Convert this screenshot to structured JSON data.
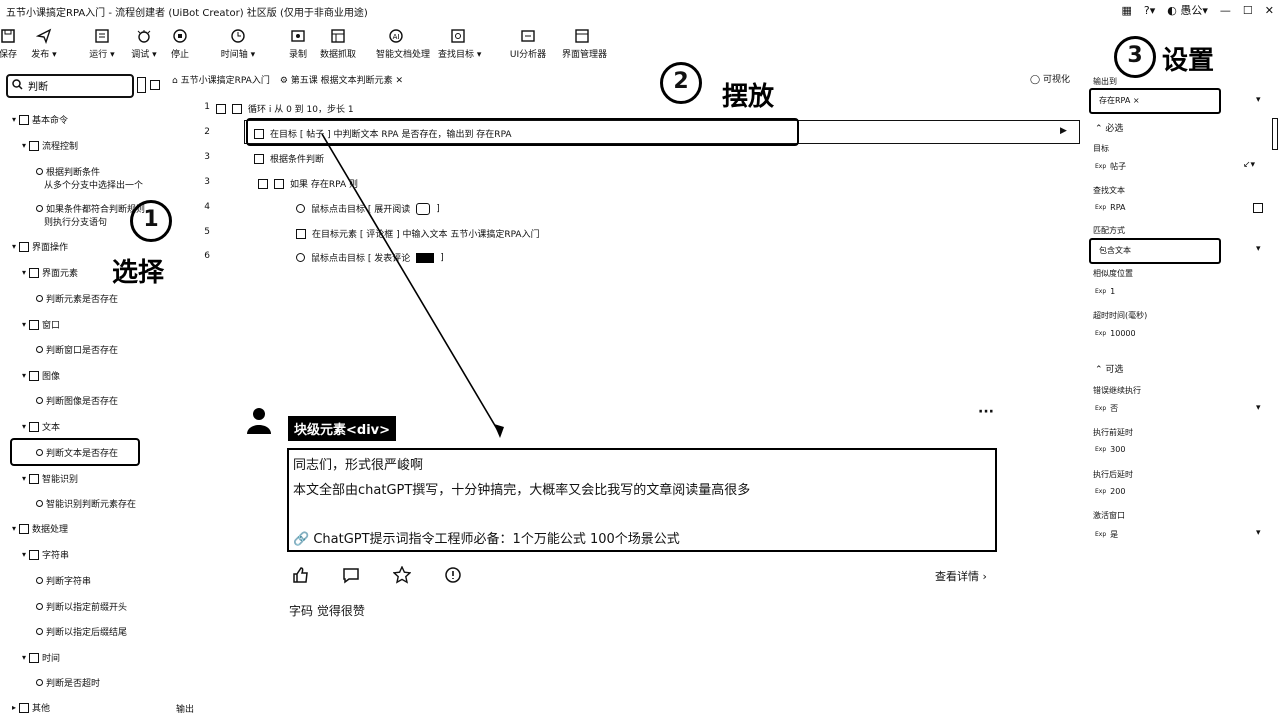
{
  "window": {
    "title": "五节小课搞定RPA入门 - 流程创建者 (UiBot Creator) 社区版 (仅用于非商业用途)",
    "user": "愚公"
  },
  "toolbar": [
    {
      "label": "保存",
      "icon": "save-icon"
    },
    {
      "label": "发布 ▾",
      "icon": "send-icon"
    },
    {
      "label": "运行 ▾",
      "icon": "run-icon"
    },
    {
      "label": "调试 ▾",
      "icon": "debug-icon"
    },
    {
      "label": "停止",
      "icon": "stop-icon"
    },
    {
      "label": "时间轴 ▾",
      "icon": "clock-icon"
    },
    {
      "label": "录制",
      "icon": "record-icon"
    },
    {
      "label": "数据抓取",
      "icon": "grab-icon"
    },
    {
      "label": "智能文档处理",
      "icon": "ai-doc-icon"
    },
    {
      "label": "查找目标 ▾",
      "icon": "target-icon"
    },
    {
      "label": "UI分析器",
      "icon": "ui-analyzer-icon"
    },
    {
      "label": "界面管理器",
      "icon": "ui-manager-icon"
    }
  ],
  "left_panel": {
    "search_value": "判断",
    "tree": [
      {
        "label": "基本命令",
        "level": 0
      },
      {
        "label": "流程控制",
        "level": 1
      },
      {
        "label": "根据判断条件",
        "sub": "从多个分支中选择出一个",
        "level": 2
      },
      {
        "label": "如果条件都符合判断规则",
        "sub": "则执行分支语句",
        "level": 2
      },
      {
        "label": "界面操作",
        "level": 0
      },
      {
        "label": "界面元素",
        "level": 1
      },
      {
        "label": "判断元素是否存在",
        "level": 2
      },
      {
        "label": "窗口",
        "level": 1
      },
      {
        "label": "判断窗口是否存在",
        "level": 2
      },
      {
        "label": "图像",
        "level": 1
      },
      {
        "label": "判断图像是否存在",
        "level": 2
      },
      {
        "label": "文本",
        "level": 1
      },
      {
        "label": "判断文本是否存在",
        "level": 2
      },
      {
        "label": "智能识别",
        "level": 1
      },
      {
        "label": "智能识别判断元素存在",
        "level": 2
      },
      {
        "label": "数据处理",
        "level": 0
      },
      {
        "label": "字符串",
        "level": 1
      },
      {
        "label": "判断字符串",
        "level": 2
      },
      {
        "label": "判断以指定前缀开头",
        "level": 2
      },
      {
        "label": "判断以指定后缀结尾",
        "level": 2
      },
      {
        "label": "时间",
        "level": 1
      },
      {
        "label": "判断是否超时",
        "level": 2
      },
      {
        "label": "其他",
        "level": 0
      }
    ],
    "footer_label": "输出"
  },
  "crumbs": {
    "first": "五节小课搞定RPA入门",
    "tab": "第五课 根据文本判断元素"
  },
  "visual_label": "可视化",
  "flow": [
    {
      "ln": "1",
      "text": "循环 i 从 0 到 10，步长 1"
    },
    {
      "ln": "2",
      "text": "在目标 [ 帖子 ] 中判断文本 RPA 是否存在，输出到 存在RPA"
    },
    {
      "ln": "3",
      "text": "根据条件判断"
    },
    {
      "ln": "3",
      "text": "如果 存在RPA 则"
    },
    {
      "ln": "4",
      "text": "鼠标点击目标 [ 展开阅读"
    },
    {
      "ln": "5",
      "text": "在目标元素 [ 评论框 ] 中输入文本 五节小课搞定RPA入门"
    },
    {
      "ln": "6",
      "text": "鼠标点击目标 [ 发表评论"
    }
  ],
  "annotations": {
    "a1_num": "1",
    "a1_text": "选择",
    "a2_num": "2",
    "a2_text": "摆放",
    "a3_num": "3",
    "a3_text": "设置"
  },
  "article": {
    "badge": "块级元素<div>",
    "lines": [
      "同志们，形式很严峻啊",
      "本文全部由chatGPT撰写，十分钟搞完，大概率又会比我写的文章阅读量高很多",
      "",
      "🔗 ChatGPT提示词指令工程师必备：1个万能公式 100个场景公式"
    ],
    "more_label": "查看详情 ›",
    "comment": "字码 觉得很赞"
  },
  "right_panel": {
    "top_label": "输出到",
    "top_value": "存在RPA ×",
    "required": "必选",
    "fields": [
      {
        "label": "目标",
        "value": "帖子"
      },
      {
        "label": "查找文本",
        "value": "RPA"
      }
    ],
    "match_label": "匹配方式",
    "match_value": "包含文本",
    "fields2": [
      {
        "label": "相似度位置",
        "value": "1"
      },
      {
        "label": "超时时间(毫秒)",
        "value": "10000"
      }
    ],
    "optional": "可选",
    "fields3": [
      {
        "label": "错误继续执行",
        "value": "否"
      },
      {
        "label": "执行前延时",
        "value": "300"
      },
      {
        "label": "执行后延时",
        "value": "200"
      },
      {
        "label": "激活窗口",
        "value": "是"
      }
    ]
  }
}
